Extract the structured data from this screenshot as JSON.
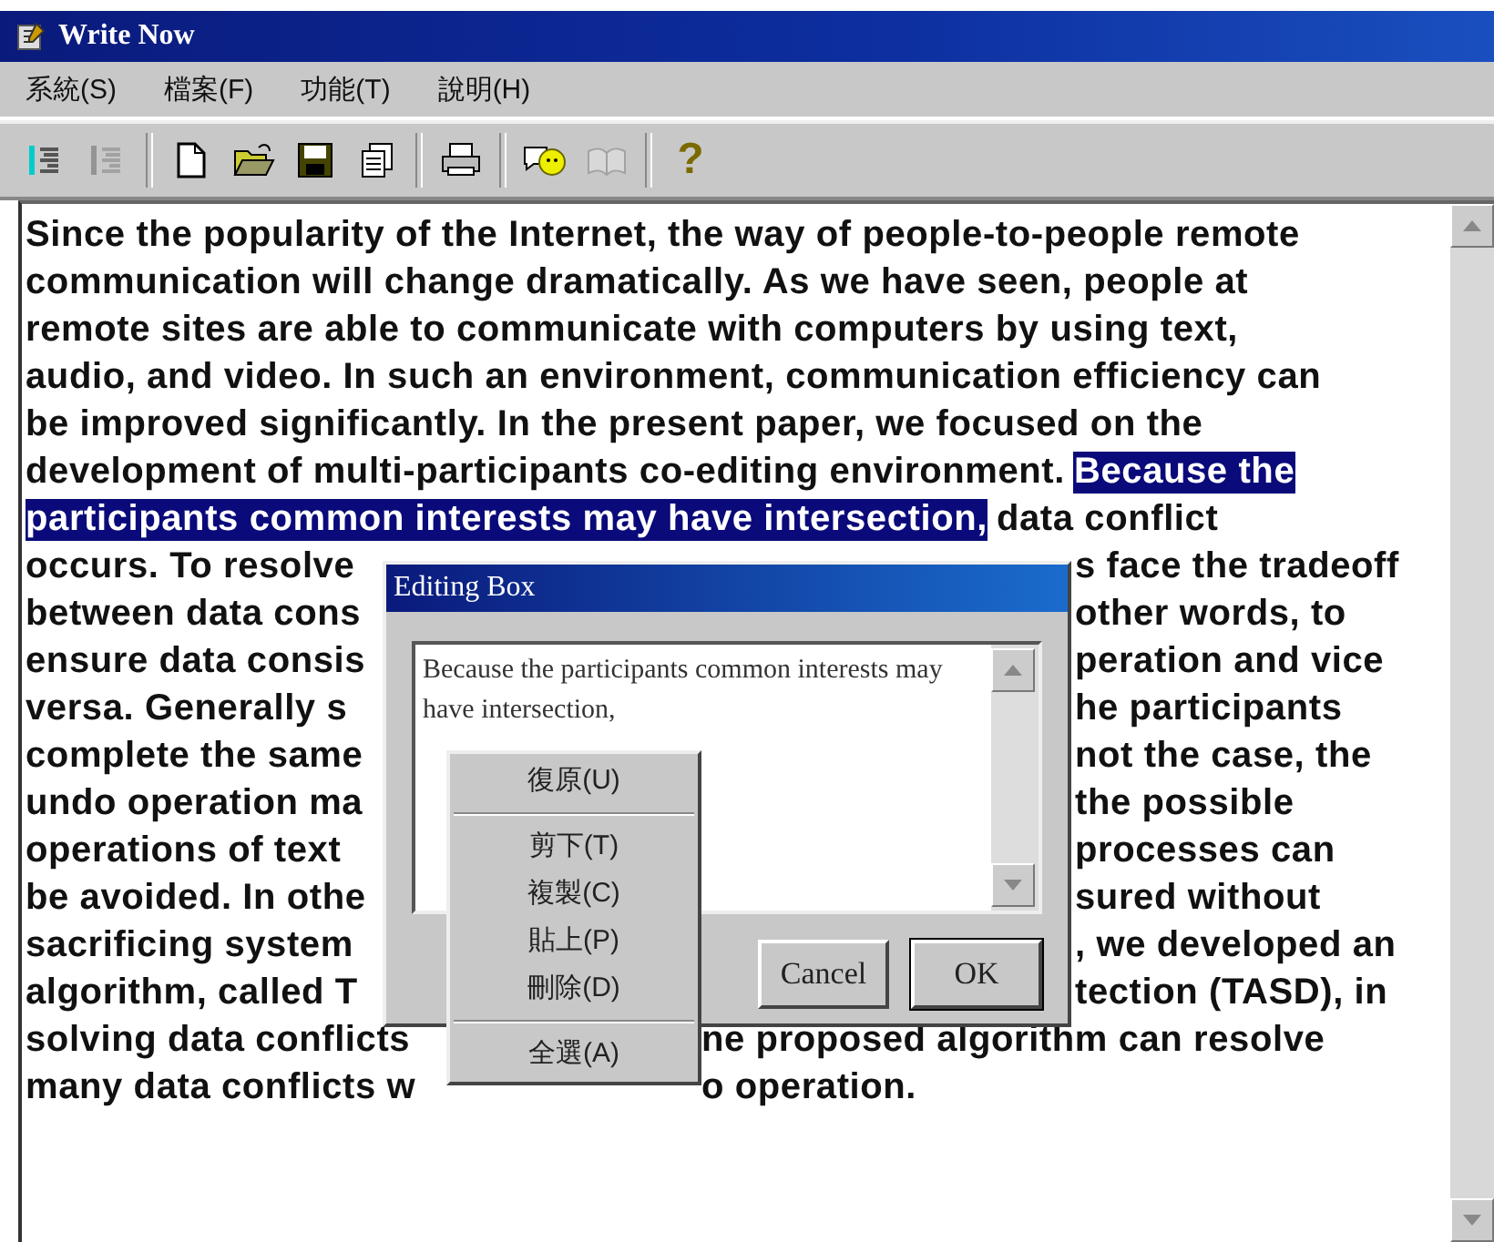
{
  "window": {
    "title": "Write Now"
  },
  "menu": [
    "系統(S)",
    "檔案(F)",
    "功能(T)",
    "說明(H)"
  ],
  "toolbar": [
    {
      "kind": "cursor",
      "disabled": false
    },
    {
      "kind": "cursor",
      "disabled": true
    },
    {
      "kind": "separator"
    },
    {
      "kind": "new"
    },
    {
      "kind": "open"
    },
    {
      "kind": "save"
    },
    {
      "kind": "copy"
    },
    {
      "kind": "separator"
    },
    {
      "kind": "print"
    },
    {
      "kind": "separator"
    },
    {
      "kind": "chat",
      "disabled": false
    },
    {
      "kind": "book",
      "disabled": true
    },
    {
      "kind": "separator"
    },
    {
      "kind": "help",
      "glyph": "?"
    }
  ],
  "document": {
    "lines": [
      {
        "kind": "full",
        "segments": [
          {
            "text": "Since the popularity of the Internet, the way of people-to-people remote",
            "selected": false
          }
        ]
      },
      {
        "kind": "full",
        "segments": [
          {
            "text": "communication will change dramatically. As we have seen, people at",
            "selected": false
          }
        ]
      },
      {
        "kind": "full",
        "segments": [
          {
            "text": "remote sites are able to communicate with computers by using text,",
            "selected": false
          }
        ]
      },
      {
        "kind": "full",
        "segments": [
          {
            "text": "audio, and video. In such an environment, communication efficiency can",
            "selected": false
          }
        ]
      },
      {
        "kind": "full",
        "segments": [
          {
            "text": "be improved significantly. In the present paper, we focused on the",
            "selected": false
          }
        ]
      },
      {
        "kind": "full",
        "segments": [
          {
            "text": "development of multi-participants co-editing environment.",
            "selected": false
          },
          {
            "text": "Because the",
            "selected": true
          }
        ]
      },
      {
        "kind": "full",
        "segments": [
          {
            "text": "participants common interests may have intersection,",
            "selected": true
          },
          {
            "text": "data conflict",
            "selected": false
          }
        ]
      },
      {
        "kind": "behind_dialog",
        "segments": [
          {
            "text": "occurs. To resolve",
            "selected": false
          },
          {
            "text": "s face the tradeoff",
            "selected": false
          }
        ]
      },
      {
        "kind": "behind_dialog",
        "segments": [
          {
            "text": "between data cons",
            "selected": false
          },
          {
            "text": "other words, to",
            "selected": false
          }
        ]
      },
      {
        "kind": "behind_dialog",
        "segments": [
          {
            "text": "ensure data consis",
            "selected": false
          },
          {
            "text": "peration and vice",
            "selected": false
          }
        ]
      },
      {
        "kind": "behind_dialog",
        "segments": [
          {
            "text": "versa. Generally s",
            "selected": false
          },
          {
            "text": "he participants",
            "selected": false
          }
        ]
      },
      {
        "kind": "behind_dialog",
        "segments": [
          {
            "text": "complete the same",
            "selected": false
          },
          {
            "text": "not the case, the",
            "selected": false
          }
        ]
      },
      {
        "kind": "behind_dialog",
        "segments": [
          {
            "text": "undo operation ma",
            "selected": false
          },
          {
            "text": "the possible",
            "selected": false
          }
        ]
      },
      {
        "kind": "behind_dialog",
        "segments": [
          {
            "text": "operations of text",
            "selected": false
          },
          {
            "text": "processes can",
            "selected": false
          }
        ]
      },
      {
        "kind": "behind_dialog",
        "segments": [
          {
            "text": "be avoided. In othe",
            "selected": false
          },
          {
            "text": "sured without",
            "selected": false
          }
        ]
      },
      {
        "kind": "behind_dialog",
        "segments": [
          {
            "text": "sacrificing system",
            "selected": false
          },
          {
            "text": ", we developed an",
            "selected": false
          }
        ]
      },
      {
        "kind": "behind_dialog",
        "segments": [
          {
            "text": "algorithm, called T",
            "selected": false
          },
          {
            "text": "tection (TASD), in",
            "selected": false
          }
        ]
      },
      {
        "kind": "behind_menu",
        "segments": [
          {
            "text": "solving data conflicts",
            "selected": false
          },
          {
            "text": "ne proposed algorithm can resolve",
            "selected": false
          }
        ]
      },
      {
        "kind": "behind_menu",
        "segments": [
          {
            "text": "many data conflicts w",
            "selected": false
          },
          {
            "text": "o operation.",
            "selected": false
          }
        ]
      }
    ]
  },
  "dialog": {
    "title": "Editing Box",
    "text": "Because the participants common interests may have intersection,",
    "buttons": [
      {
        "label": "Cancel",
        "default": false
      },
      {
        "label": "OK",
        "default": true
      }
    ]
  },
  "context_menu": {
    "items": [
      {
        "kind": "item",
        "label": "復原(U)"
      },
      {
        "kind": "separator"
      },
      {
        "kind": "item",
        "label": "剪下(T)"
      },
      {
        "kind": "item",
        "label": "複製(C)"
      },
      {
        "kind": "item",
        "label": "貼上(P)"
      },
      {
        "kind": "item",
        "label": "刪除(D)"
      },
      {
        "kind": "separator"
      },
      {
        "kind": "item",
        "label": "全選(A)"
      }
    ]
  }
}
